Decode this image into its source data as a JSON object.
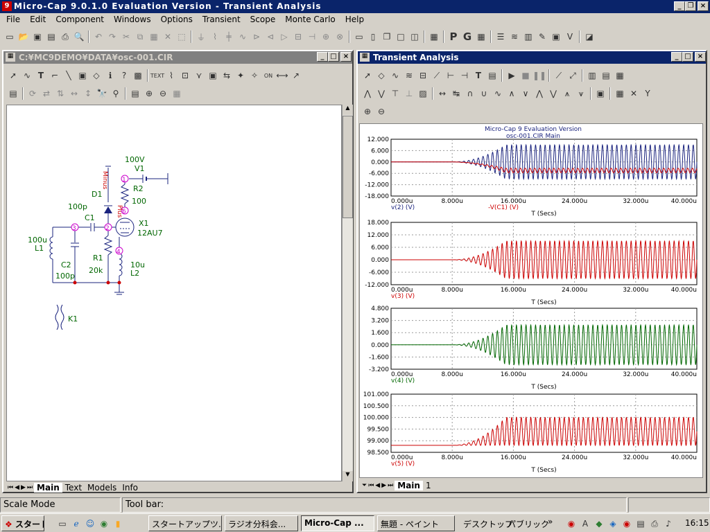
{
  "app": {
    "title": "Micro-Cap 9.0.1.0 Evaluation Version - Transient Analysis"
  },
  "menu": [
    "File",
    "Edit",
    "Component",
    "Windows",
    "Options",
    "Transient",
    "Scope",
    "Monte Carlo",
    "Help"
  ],
  "schematic": {
    "title": "C:¥MC9DEMO¥DATA¥osc-001.CIR",
    "tabs": [
      "Main",
      "Text",
      "Models",
      "Info"
    ],
    "labels": {
      "v1_val": "100V",
      "v1": "V1",
      "minus": "Minus",
      "d1": "D1",
      "r2": "R2",
      "r2_val": "100",
      "cap100p": "100p",
      "c1": "C1",
      "plus": "Plus",
      "x1": "X1",
      "x1_model": "12AU7",
      "l1_val": "100u",
      "l1": "L1",
      "c2": "C2",
      "c2_val": "100p",
      "r1": "R1",
      "r1_val": "20k",
      "l2_val": "10u",
      "l2": "L2",
      "k1": "K1",
      "n1": "1",
      "n2": "2",
      "n3": "3",
      "n4": "4",
      "n5": "5",
      "n6": "6"
    }
  },
  "analysis": {
    "title": "Transient Analysis",
    "header1": "Micro-Cap 9 Evaluation Version",
    "header2": "osc-001.CIR Main",
    "tabs": [
      "Main",
      "1"
    ],
    "xticks": [
      "0.000u",
      "8.000u",
      "16.000u",
      "24.000u",
      "32.000u",
      "40.000u"
    ],
    "xlabel": "T (Secs)"
  },
  "chart_data": [
    {
      "type": "line",
      "xlim": [
        0,
        40
      ],
      "ylim": [
        -18,
        12
      ],
      "yticks": [
        "12.000",
        "6.000",
        "0.000",
        "-6.000",
        "-12.000",
        "-18.000"
      ],
      "xlabel": "T (Secs)",
      "series": [
        {
          "name": "v(2) (V)",
          "color": "#1a237e"
        },
        {
          "name": "-V(C1) (V)",
          "color": "#cc0000"
        }
      ]
    },
    {
      "type": "line",
      "xlim": [
        0,
        40
      ],
      "ylim": [
        -12,
        18
      ],
      "yticks": [
        "18.000",
        "12.000",
        "6.000",
        "0.000",
        "-6.000",
        "-12.000"
      ],
      "xlabel": "T (Secs)",
      "series": [
        {
          "name": "v(3) (V)",
          "color": "#cc0000"
        }
      ]
    },
    {
      "type": "line",
      "xlim": [
        0,
        40
      ],
      "ylim": [
        -3.2,
        4.8
      ],
      "yticks": [
        "4.800",
        "3.200",
        "1.600",
        "0.000",
        "-1.600",
        "-3.200"
      ],
      "xlabel": "T (Secs)",
      "series": [
        {
          "name": "v(4) (V)",
          "color": "#006600"
        }
      ]
    },
    {
      "type": "line",
      "xlim": [
        0,
        40
      ],
      "ylim": [
        98.5,
        101
      ],
      "yticks": [
        "101.000",
        "100.500",
        "100.000",
        "99.500",
        "99.000",
        "98.500"
      ],
      "xlabel": "T (Secs)",
      "series": [
        {
          "name": "v(5) (V)",
          "color": "#cc0000"
        }
      ]
    }
  ],
  "status": {
    "mode": "Scale Mode",
    "toolbar": "Tool bar:"
  },
  "taskbar": {
    "start": "スタート",
    "items": [
      "スタートアップツ...",
      "ラジオ分科会...",
      "Micro-Cap ...",
      "無題 - ペイント"
    ],
    "desktop": "デスクトップ",
    "public": "パブリック",
    "clock": "16:15"
  },
  "colors": {
    "titlebar": "#0a246a",
    "blue": "#1a237e",
    "red": "#cc0000",
    "green": "#006600"
  }
}
